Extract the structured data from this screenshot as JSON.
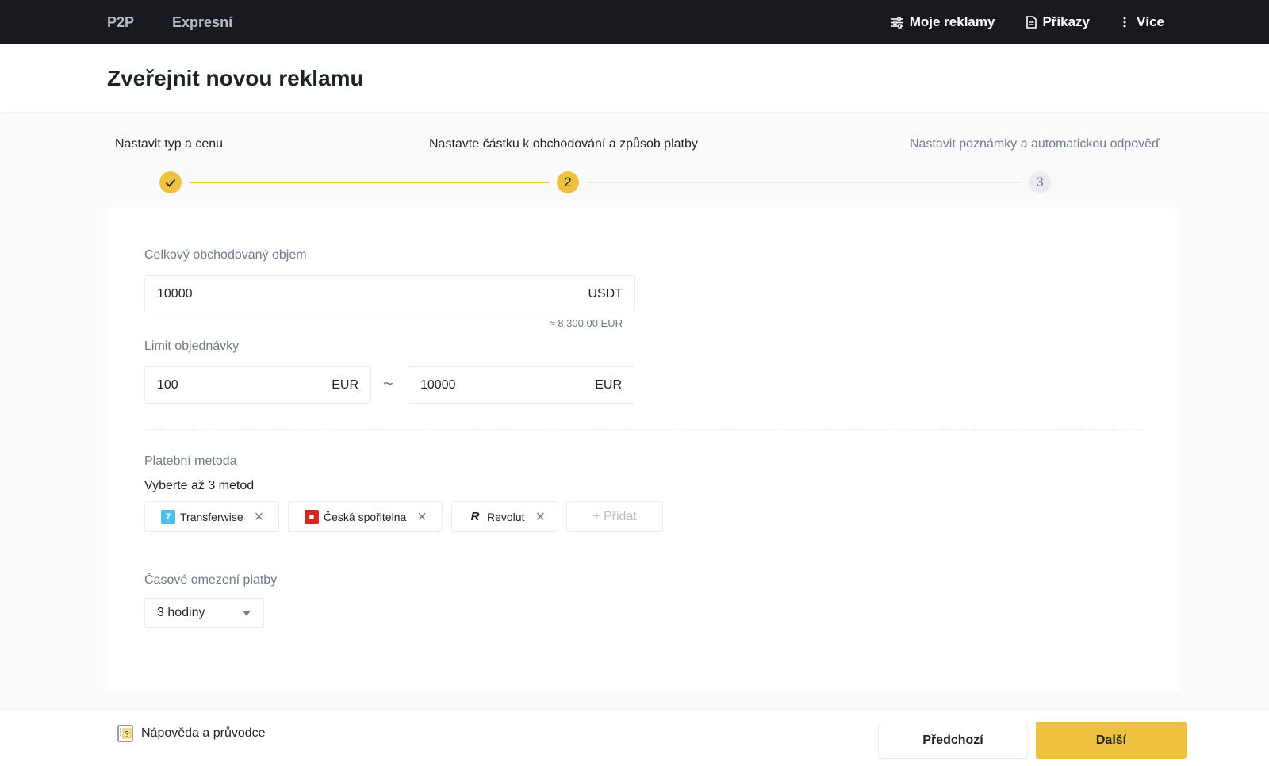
{
  "nav": {
    "left": [
      "P2P",
      "Expresní"
    ],
    "my_ads": "Moje reklamy",
    "orders": "Příkazy",
    "more": "Více"
  },
  "page": {
    "title": "Zveřejnit novou reklamu"
  },
  "stepper": {
    "step1": "Nastavit typ a cenu",
    "step2": "Nastavte částku k obchodování a způsob platby",
    "step3": "Nastavit poznámky a automatickou odpověď",
    "step2_number": "2",
    "step3_number": "3",
    "current_step": 2
  },
  "form": {
    "total_label": "Celkový obchodovaný objem",
    "total_value": "10000",
    "total_unit": "USDT",
    "total_approx": "≈ 8,300.00 EUR",
    "limit_label": "Limit objednávky",
    "limit_min": "100",
    "limit_min_unit": "EUR",
    "limit_separator": "~",
    "limit_max": "10000",
    "limit_max_unit": "EUR",
    "payment_label": "Platební metoda",
    "payment_hint": "Vyberte až 3 metod",
    "payment_methods": [
      {
        "name": "Transferwise",
        "icon": "transferwise-logo",
        "color": "#48c0f0"
      },
      {
        "name": "Česká spořitelna",
        "icon": "ceska-sporitelna-logo",
        "color": "#d4261c"
      },
      {
        "name": "Revolut",
        "icon": "revolut-logo",
        "color": "#1e2329"
      }
    ],
    "add_label": "+ Přidat",
    "time_label": "Časové omezení platby",
    "time_value": "3 hodiny"
  },
  "footer": {
    "help": "Nápověda a průvodce",
    "prev": "Předchozí",
    "next": "Další"
  },
  "colors": {
    "accent": "#eec23f",
    "nav_bg": "#181a20"
  }
}
